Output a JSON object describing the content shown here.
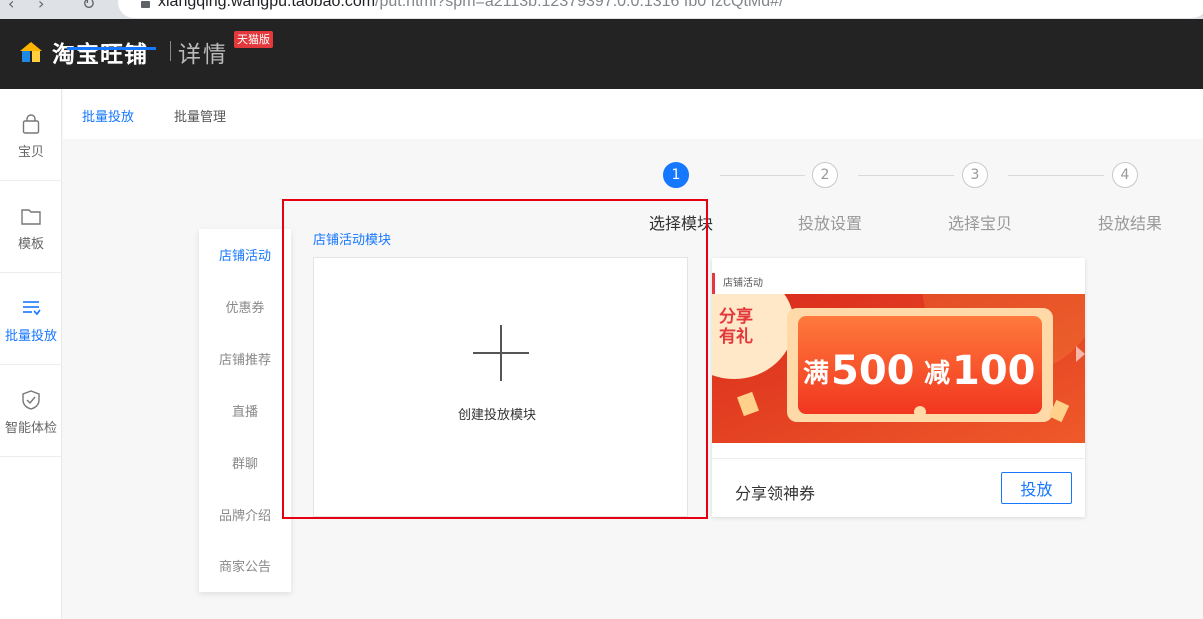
{
  "browser": {
    "url_host": "xiangqing.wangpu.taobao.com",
    "url_path": "/put.html?spm=a2113b.12379397.0.0.1316 fb0 fzcQtMd#/"
  },
  "header": {
    "brand": "淘宝旺铺",
    "subtitle": "详情",
    "badge": "天猫版"
  },
  "sidebar": {
    "items": [
      {
        "label": "宝贝",
        "icon": "bag-icon"
      },
      {
        "label": "模板",
        "icon": "folder-icon"
      },
      {
        "label": "批量投放",
        "icon": "list-icon"
      },
      {
        "label": "智能体检",
        "icon": "shield-check-icon"
      }
    ]
  },
  "tabs": [
    "批量投放",
    "批量管理"
  ],
  "steps": [
    {
      "num": "1",
      "label": "选择模块"
    },
    {
      "num": "2",
      "label": "投放设置"
    },
    {
      "num": "3",
      "label": "选择宝贝"
    },
    {
      "num": "4",
      "label": "投放结果"
    }
  ],
  "categories": [
    "店铺活动",
    "优惠券",
    "店铺推荐",
    "直播",
    "群聊",
    "品牌介绍",
    "商家公告"
  ],
  "module": {
    "title": "店铺活动模块",
    "create_label": "创建投放模块"
  },
  "activity_card": {
    "tag": "店铺活动",
    "banner_left_line1": "分享",
    "banner_left_line2": "有礼",
    "banner_prefix": "满",
    "banner_amount1": "500",
    "banner_mid": "减",
    "banner_amount2": "100",
    "name": "分享领神券",
    "button": "投放"
  },
  "colors": {
    "accent": "#1677ff",
    "header_bg": "#232323",
    "highlight": "#e60012",
    "banner_red": "#e2341d"
  }
}
